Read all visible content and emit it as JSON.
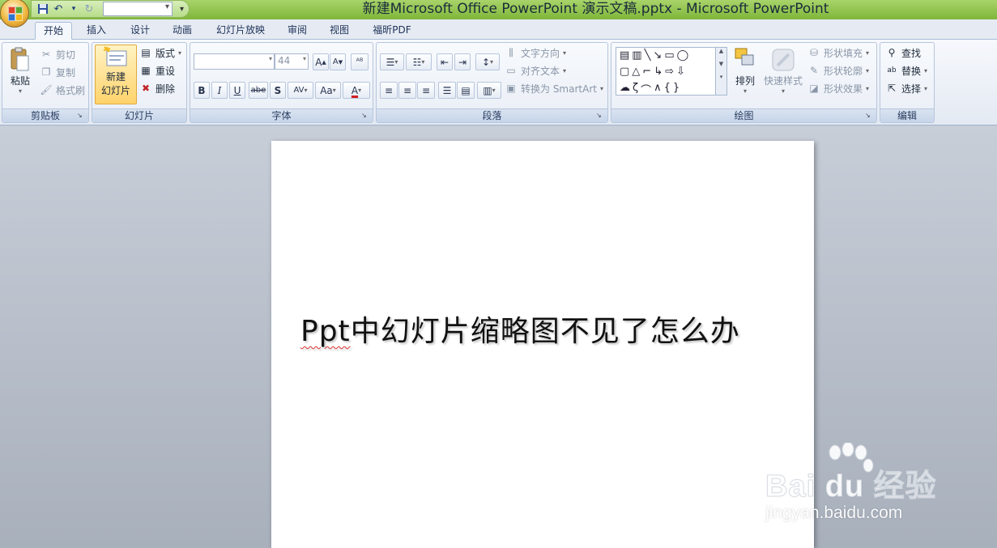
{
  "titlebar": {
    "title": "新建Microsoft Office PowerPoint 演示文稿.pptx - Microsoft PowerPoint"
  },
  "quick_access": {
    "icons": [
      "save-icon",
      "undo-icon",
      "redo-icon"
    ]
  },
  "tabs": [
    {
      "label": "开始",
      "active": true
    },
    {
      "label": "插入"
    },
    {
      "label": "设计"
    },
    {
      "label": "动画"
    },
    {
      "label": "幻灯片放映"
    },
    {
      "label": "审阅"
    },
    {
      "label": "视图"
    },
    {
      "label": "福昕PDF"
    }
  ],
  "ribbon": {
    "clipboard": {
      "label": "剪贴板",
      "paste": "粘贴",
      "cut": "剪切",
      "copy": "复制",
      "format_painter": "格式刷"
    },
    "slides": {
      "label": "幻灯片",
      "new_slide_line1": "新建",
      "new_slide_line2": "幻灯片",
      "layout": "版式",
      "reset": "重设",
      "delete": "删除"
    },
    "font": {
      "label": "字体",
      "font_name": "",
      "font_size": "44",
      "bold": "B",
      "italic": "I",
      "underline": "U",
      "strike": "abe",
      "shadow": "S",
      "spacing": "AV",
      "case": "Aa",
      "color": "A",
      "grow": "A",
      "shrink": "A"
    },
    "paragraph": {
      "label": "段落",
      "text_direction": "文字方向",
      "align_text": "对齐文本",
      "convert_smartart": "转换为 SmartArt"
    },
    "drawing": {
      "label": "绘图",
      "arrange": "排列",
      "quick_styles": "快速样式",
      "shape_fill": "形状填充",
      "shape_outline": "形状轮廓",
      "shape_effects": "形状效果"
    },
    "editing": {
      "label": "编辑",
      "find": "查找",
      "replace": "替换",
      "select": "选择"
    }
  },
  "slide": {
    "title_prefix": "Ppt",
    "title_rest": "中幻灯片缩略图不见了怎么办"
  },
  "watermark": {
    "brand": "Bai du 经验",
    "url": "jingyan.baidu.com"
  },
  "colors": {
    "titlebar": "#8cc04a",
    "workspace": "#b4bbc6",
    "ribbon": "#eef2f8"
  }
}
